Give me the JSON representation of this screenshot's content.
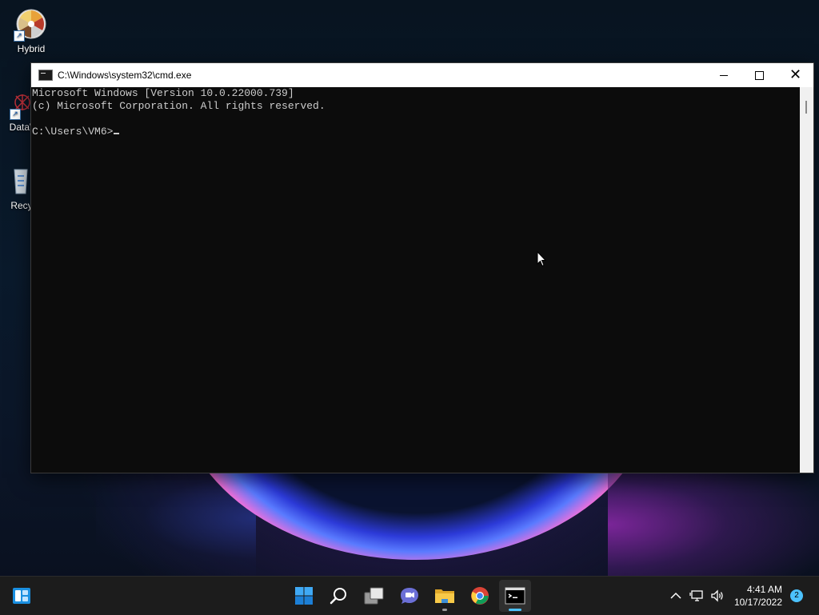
{
  "desktop": {
    "icons": [
      {
        "label": "Hybrid"
      },
      {
        "label": "DataW"
      },
      {
        "label": "Recyc"
      }
    ]
  },
  "window": {
    "title": "C:\\Windows\\system32\\cmd.exe",
    "console_lines": [
      "Microsoft Windows [Version 10.0.22000.739]",
      "(c) Microsoft Corporation. All rights reserved.",
      "",
      "C:\\Users\\VM6>"
    ]
  },
  "taskbar": {
    "apps": [
      {
        "name": "start",
        "icon": "windows-logo-icon"
      },
      {
        "name": "search",
        "icon": "search-icon"
      },
      {
        "name": "task-view",
        "icon": "task-view-icon"
      },
      {
        "name": "chat",
        "icon": "teams-chat-icon"
      },
      {
        "name": "file-explorer",
        "icon": "folder-icon"
      },
      {
        "name": "chrome",
        "icon": "chrome-icon"
      },
      {
        "name": "command-prompt",
        "icon": "terminal-icon"
      }
    ],
    "clock": {
      "time": "4:41 AM",
      "date": "10/17/2022"
    },
    "notification_count": "2"
  },
  "colors": {
    "console_bg": "#0c0c0c",
    "console_fg": "#cccccc",
    "accent": "#4cc2ff",
    "taskbar_bg": "#1c1c1c"
  }
}
